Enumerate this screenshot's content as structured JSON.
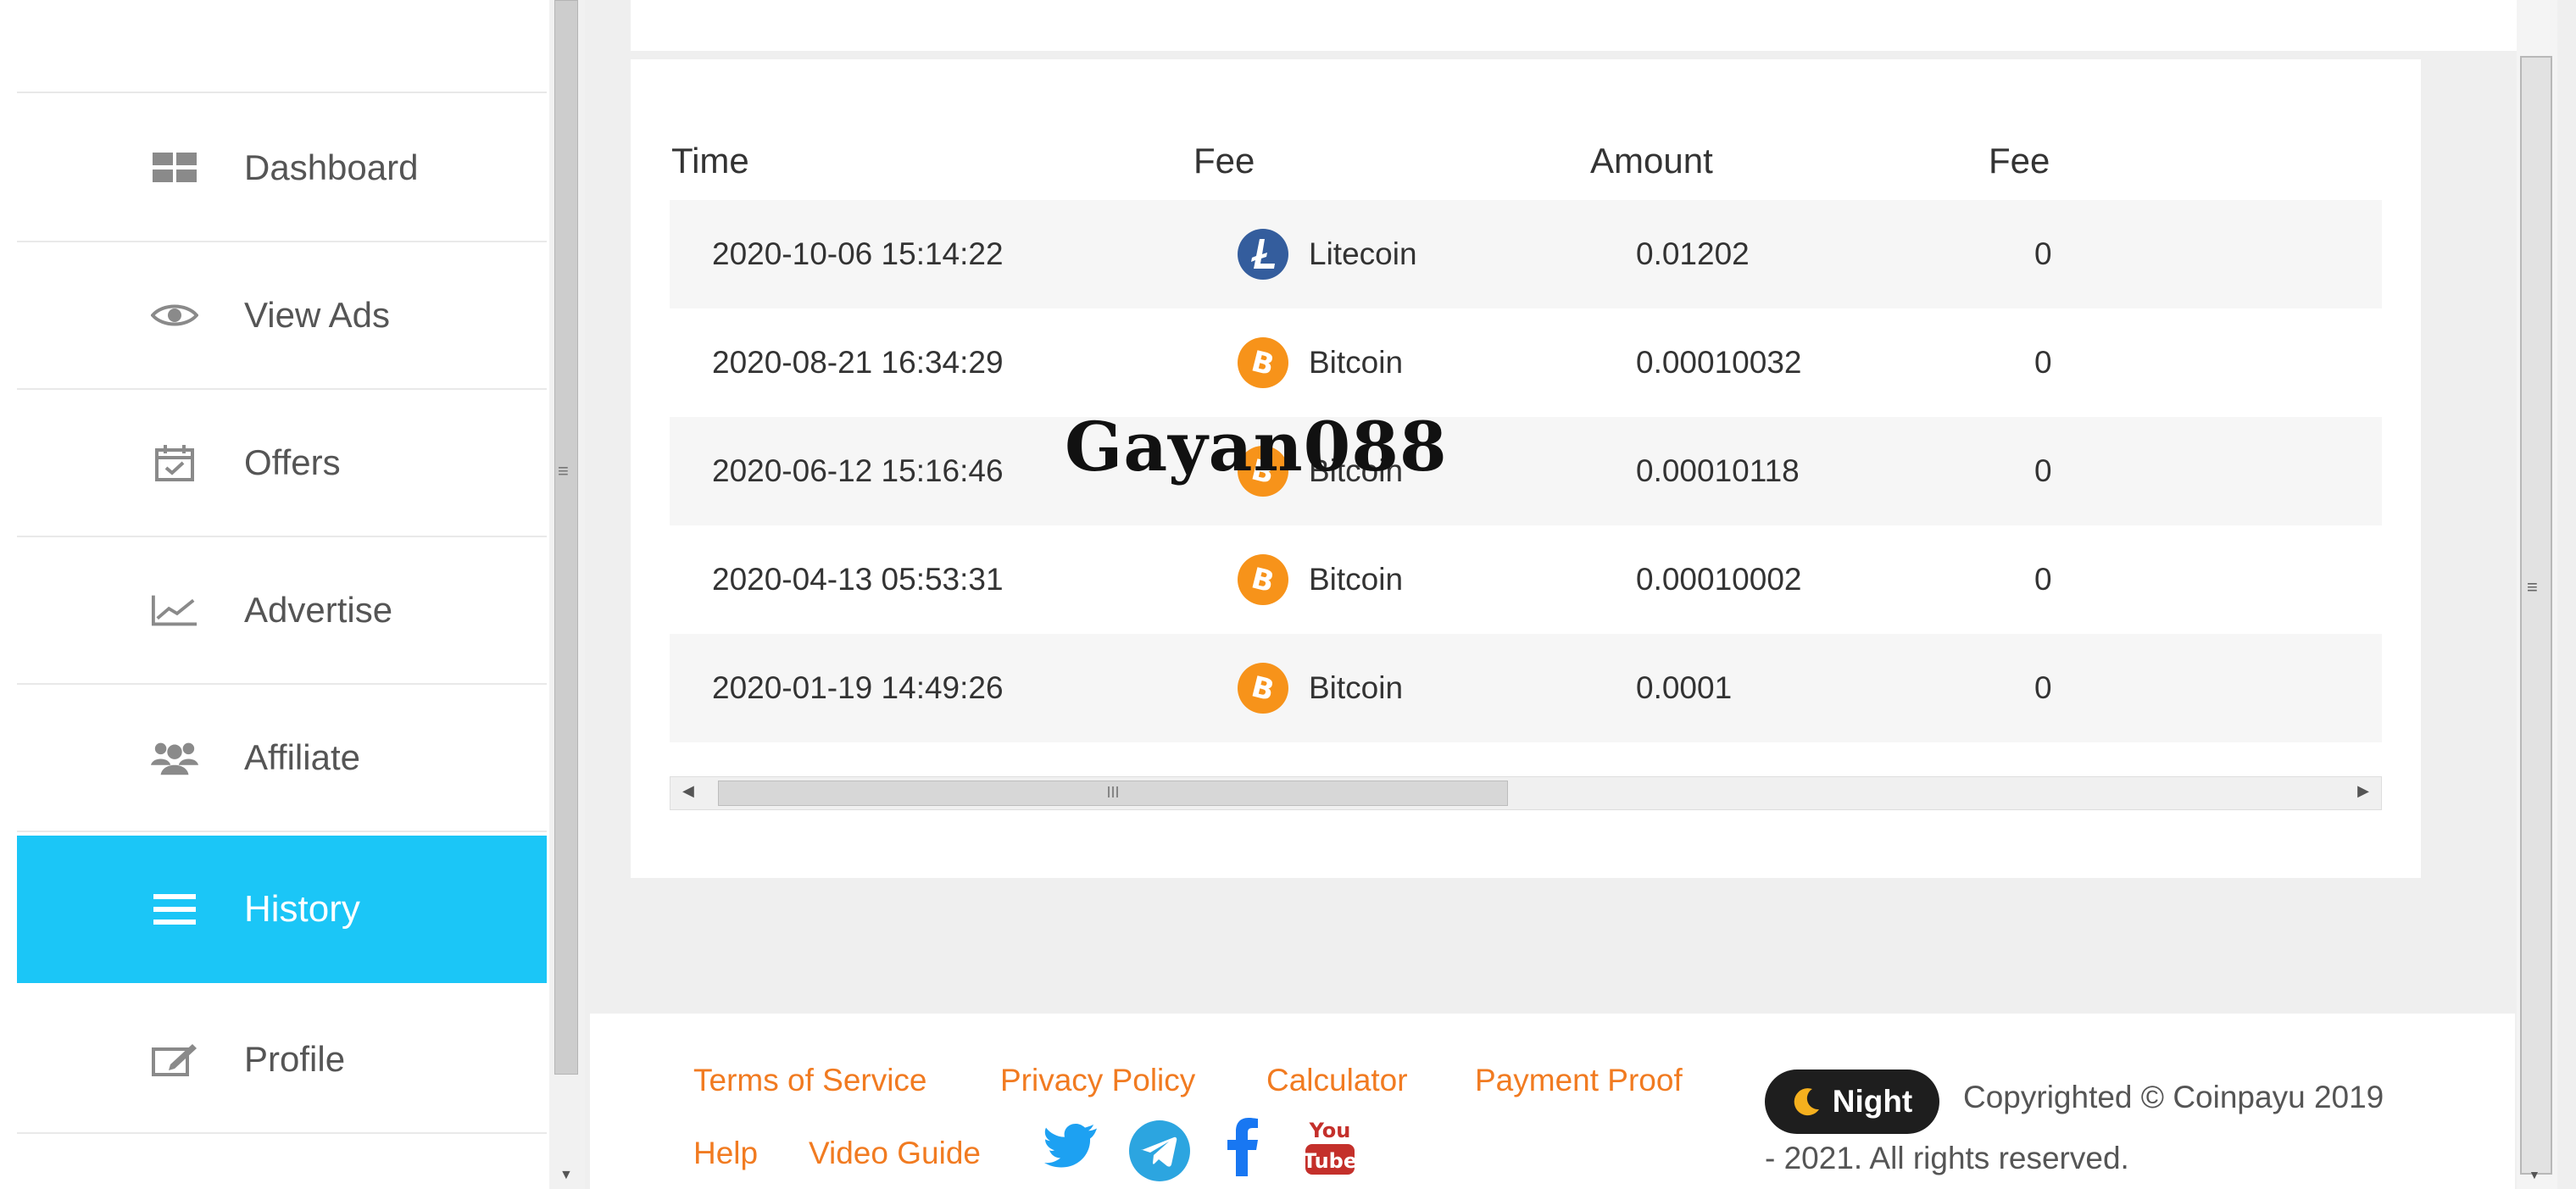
{
  "sidebar": {
    "items": [
      {
        "label": "Dashboard",
        "icon": "dashboard-grid-icon"
      },
      {
        "label": "View Ads",
        "icon": "eye-icon"
      },
      {
        "label": "Offers",
        "icon": "calendar-check-icon"
      },
      {
        "label": "Advertise",
        "icon": "chart-line-icon"
      },
      {
        "label": "Affiliate",
        "icon": "users-icon"
      },
      {
        "label": "History",
        "icon": "list-icon",
        "active": true
      },
      {
        "label": "Profile",
        "icon": "edit-icon"
      }
    ],
    "active_color": "#1bc6f7"
  },
  "table": {
    "headers": [
      "Time",
      "Fee",
      "Amount",
      "Fee"
    ],
    "rows": [
      {
        "time": "2020-10-06 15:14:22",
        "coin": "Litecoin",
        "amount": "0.01202",
        "fee": "0"
      },
      {
        "time": "2020-08-21 16:34:29",
        "coin": "Bitcoin",
        "amount": "0.00010032",
        "fee": "0"
      },
      {
        "time": "2020-06-12 15:16:46",
        "coin": "Bitcoin",
        "amount": "0.00010118",
        "fee": "0"
      },
      {
        "time": "2020-04-13 05:53:31",
        "coin": "Bitcoin",
        "amount": "0.00010002",
        "fee": "0"
      },
      {
        "time": "2020-01-19 14:49:26",
        "coin": "Bitcoin",
        "amount": "0.0001",
        "fee": "0"
      }
    ]
  },
  "watermark": "Gayan088",
  "footer": {
    "links": [
      "Terms of Service",
      "Privacy Policy",
      "Calculator",
      "Payment Proof",
      "Help",
      "Video Guide"
    ],
    "night_label": "Night",
    "copyright_line1": "Copyrighted © Coinpayu 2019",
    "copyright_line2": "- 2021. All rights reserved.",
    "social_icons": [
      "twitter-icon",
      "telegram-icon",
      "facebook-icon",
      "youtube-icon"
    ],
    "link_color": "#f17b21"
  }
}
